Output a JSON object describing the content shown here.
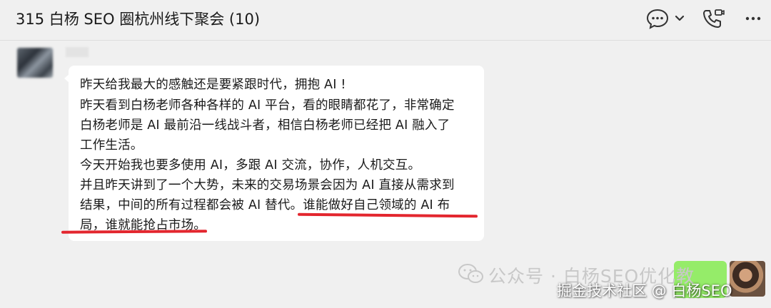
{
  "header": {
    "title": "315 白杨 SEO 圈杭州线下聚会 (10)",
    "actions": [
      "chat-bubble-icon",
      "chevron-down-icon",
      "phone-call-icon",
      "more-icon"
    ]
  },
  "message": {
    "lines": [
      "昨天给我最大的感触还是要紧跟时代，拥抱 AI !",
      "昨天看到白杨老师各种各样的 AI 平台，看的眼睛都花了，非常确定",
      "白杨老师是 AI 最前沿一线战斗者，相信白杨老师已经把 AI 融入了",
      "工作生活。",
      "今天开始我也要多使用 AI，多跟 AI 交流，协作，人机交互。",
      "并且昨天讲到了一个大势，未来的交易场景会因为 AI 直接从需求到",
      "结果，中间的所有过程都会被 AI 替代。谁能做好自己领域的 AI 布",
      "局，谁就能抢占市场。"
    ]
  },
  "watermarks": {
    "wechat": "公众号 · 白杨SEO优化教",
    "juejin": "掘金技术社区 @ 白杨SEO"
  },
  "colors": {
    "background": "#f0f0f0",
    "bubble": "#ffffff",
    "self_bubble": "#95ec69",
    "highlight_underline": "#e3262e"
  }
}
